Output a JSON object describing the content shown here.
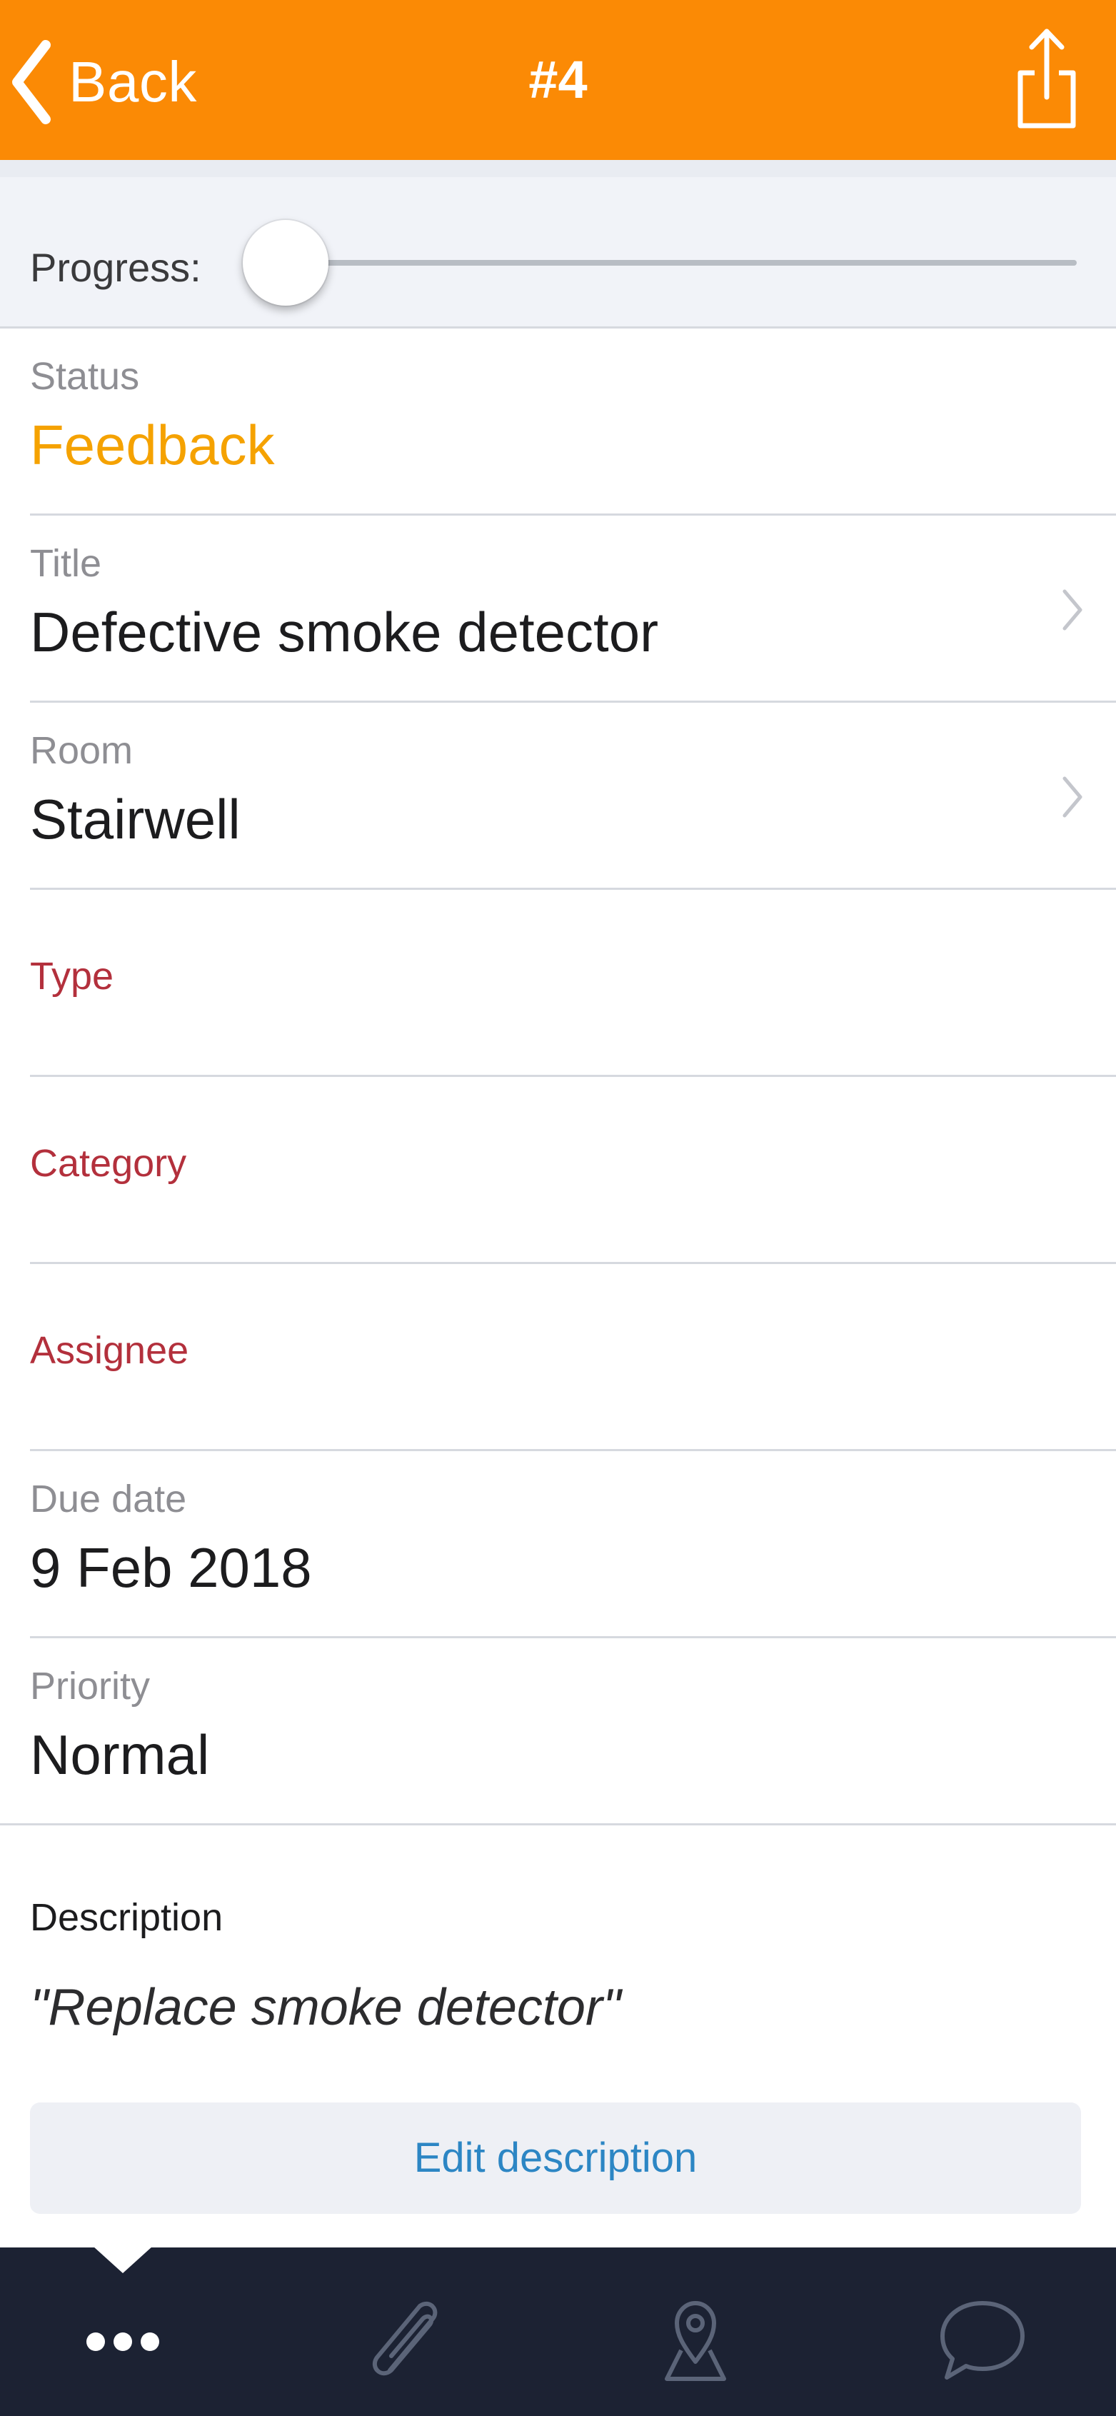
{
  "navbar": {
    "back_label": "Back",
    "title": "#4",
    "icons": {
      "back": "chevron-left-icon",
      "share": "share-icon"
    }
  },
  "progress": {
    "label": "Progress:",
    "value": 0.0
  },
  "fields": {
    "status": {
      "label": "Status",
      "value": "Feedback"
    },
    "title": {
      "label": "Title",
      "value": "Defective smoke detector"
    },
    "room": {
      "label": "Room",
      "value": "Stairwell"
    },
    "type": {
      "label": "Type",
      "value": ""
    },
    "category": {
      "label": "Category",
      "value": ""
    },
    "assignee": {
      "label": "Assignee",
      "value": ""
    },
    "due_date": {
      "label": "Due date",
      "value": "9 Feb 2018"
    },
    "priority": {
      "label": "Priority",
      "value": "Normal"
    }
  },
  "description": {
    "label": "Description",
    "text": "\"Replace smoke detector\"",
    "edit_button": "Edit description"
  },
  "tabbar": {
    "active": "more",
    "tabs": [
      {
        "id": "more",
        "icon": "more-dots-icon"
      },
      {
        "id": "attachments",
        "icon": "paperclip-icon"
      },
      {
        "id": "location",
        "icon": "map-pin-icon"
      },
      {
        "id": "comments",
        "icon": "chat-bubble-icon"
      }
    ]
  },
  "colors": {
    "navbar_bg": "#fb8a05",
    "status_value": "#f5a200",
    "required_label": "#b3303c",
    "link_blue": "#2c86c4",
    "tabbar_bg": "#1c2233"
  }
}
